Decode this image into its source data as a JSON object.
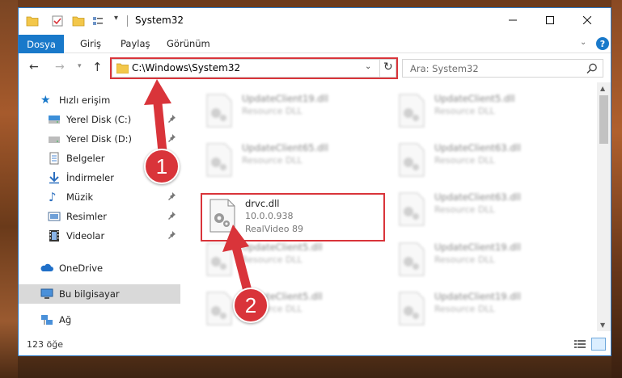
{
  "window": {
    "title": "System32",
    "controls": {
      "minimize": "─",
      "maximize": "☐",
      "close": "✕"
    }
  },
  "ribbon": {
    "tabs": [
      "Dosya",
      "Giriş",
      "Paylaş",
      "Görünüm"
    ],
    "help": "?"
  },
  "nav": {
    "address": "C:\\Windows\\System32",
    "search_placeholder": "Ara: System32"
  },
  "sidebar": {
    "items": [
      {
        "label": "Hızlı erişim",
        "icon": "star-icon",
        "pinned": false
      },
      {
        "label": "Yerel Disk (C:)",
        "icon": "drive-icon",
        "pinned": true
      },
      {
        "label": "Yerel Disk (D:)",
        "icon": "drive-icon",
        "pinned": true
      },
      {
        "label": "Belgeler",
        "icon": "documents-icon",
        "pinned": true
      },
      {
        "label": "İndirmeler",
        "icon": "downloads-icon",
        "pinned": true
      },
      {
        "label": "Müzik",
        "icon": "music-icon",
        "pinned": true
      },
      {
        "label": "Resimler",
        "icon": "pictures-icon",
        "pinned": true
      },
      {
        "label": "Videolar",
        "icon": "videos-icon",
        "pinned": true
      },
      {
        "label": "OneDrive",
        "icon": "cloud-icon",
        "pinned": false
      },
      {
        "label": "Bu bilgisayar",
        "icon": "computer-icon",
        "pinned": false
      },
      {
        "label": "Ağ",
        "icon": "network-icon",
        "pinned": false
      }
    ]
  },
  "files": [
    {
      "name": "UpdateClient19.dll",
      "type": "Resource DLL"
    },
    {
      "name": "UpdateClient5.dll",
      "type": "Resource DLL"
    },
    {
      "name": "UpdateClient65.dll",
      "type": "Resource DLL"
    },
    {
      "name": "UpdateClient63.dll",
      "type": "Resource DLL"
    },
    {
      "name": "UpdateClient5.dll",
      "type": "Resource DLL"
    },
    {
      "name": "UpdateClient19.dll",
      "type": "Resource DLL"
    },
    {
      "name": "UpdateClient5.dll",
      "type": "Resource DLL"
    },
    {
      "name": "UpdateClient19.dll",
      "type": "Resource DLL"
    },
    {
      "name": "UpdateClient63.dll",
      "type": "Resource DLL"
    }
  ],
  "highlighted_file": {
    "name": "drvc.dll",
    "version": "10.0.0.938",
    "description": "RealVideo 89"
  },
  "status": {
    "count": "123 öğe"
  },
  "annotations": {
    "step1": "1",
    "step2": "2"
  },
  "colors": {
    "accent": "#1979ca",
    "highlight": "#d9343a",
    "selected": "#cce8ff"
  }
}
